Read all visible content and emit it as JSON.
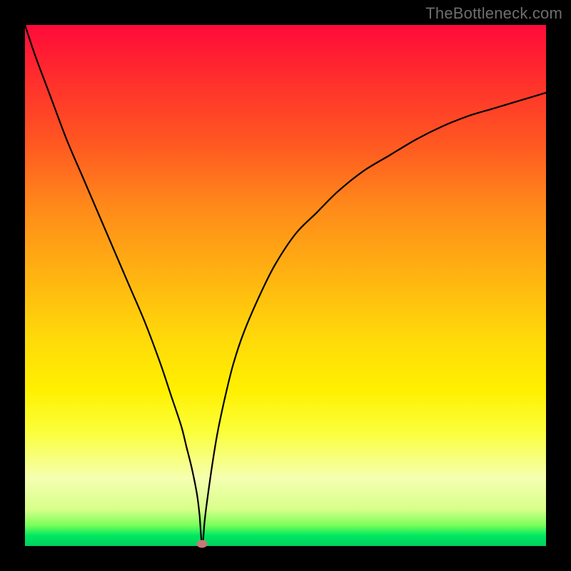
{
  "watermark": {
    "text": "TheBottleneck.com"
  },
  "chart_data": {
    "type": "line",
    "title": "",
    "xlabel": "",
    "ylabel": "",
    "xlim": [
      0,
      100
    ],
    "ylim": [
      0,
      100
    ],
    "grid": false,
    "legend": false,
    "minimum_marker": {
      "x": 34,
      "y": 0,
      "color": "#c77a74"
    },
    "background_gradient": {
      "top": "#ff0a3a",
      "bottom": "#00d060"
    },
    "series": [
      {
        "name": "bottleneck-curve",
        "color": "#000000",
        "x": [
          0,
          2,
          5,
          8,
          11,
          14,
          17,
          20,
          23,
          26,
          28,
          30,
          31,
          32,
          33,
          33.5,
          34,
          34.5,
          35,
          36,
          37,
          38.5,
          40,
          42,
          45,
          48,
          52,
          56,
          60,
          65,
          70,
          75,
          80,
          85,
          90,
          95,
          100
        ],
        "y": [
          100,
          94,
          86,
          78,
          71,
          64,
          57,
          50,
          43,
          35,
          29,
          23,
          19,
          15,
          10,
          6,
          0,
          5,
          9,
          16,
          22,
          29,
          35,
          41,
          48,
          54,
          60,
          64,
          68,
          72,
          75,
          78,
          80.5,
          82.5,
          84,
          85.5,
          87
        ]
      }
    ]
  }
}
